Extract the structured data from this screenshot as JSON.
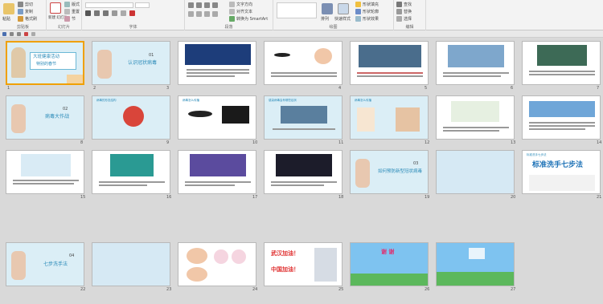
{
  "ribbon": {
    "clipboard": {
      "paste": "粘贴",
      "cut": "剪切",
      "copy": "复制",
      "format_painter": "格式刷",
      "group_label": "剪贴板"
    },
    "slides": {
      "new_slide": "新建\n幻灯片",
      "layout": "版式",
      "reset": "重置",
      "section": "节",
      "group_label": "幻灯片"
    },
    "font": {
      "group_label": "字体"
    },
    "paragraph": {
      "text_direction": "文字方向",
      "align_text": "对齐文本",
      "convert_smartart": "转换为 SmartArt",
      "group_label": "段落"
    },
    "drawing": {
      "arrange": "排列",
      "quick_styles": "快速样式",
      "shape_fill": "形状填充",
      "shape_outline": "形状轮廓",
      "shape_effects": "形状效果",
      "group_label": "绘图"
    },
    "editing": {
      "find": "查找",
      "replace": "替换",
      "select": "选择",
      "group_label": "编辑"
    }
  },
  "slides": [
    {
      "n": "1",
      "title": "大班健康活动",
      "subtitle": "特别的春节"
    },
    {
      "n": "2",
      "num": "01",
      "title": "认识冠状病毒"
    },
    {
      "n": "3"
    },
    {
      "n": "4"
    },
    {
      "n": "5"
    },
    {
      "n": "6"
    },
    {
      "n": "7"
    },
    {
      "n": "8",
      "num": "02",
      "title": "病毒大作战"
    },
    {
      "n": "9",
      "header": "病毒的形态结构"
    },
    {
      "n": "10",
      "header": "病毒怎么传播"
    },
    {
      "n": "11",
      "header": "感染病毒会有哪些症状"
    },
    {
      "n": "12",
      "header": "病毒怎么传播"
    },
    {
      "n": "13"
    },
    {
      "n": "14"
    },
    {
      "n": "15"
    },
    {
      "n": "16"
    },
    {
      "n": "17"
    },
    {
      "n": "18"
    },
    {
      "n": "19",
      "num": "03",
      "title": "如何预防新型冠状病毒"
    },
    {
      "n": "20"
    },
    {
      "n": "21",
      "header": "标准洗手七步法",
      "big": "标准洗手七步法"
    },
    {
      "n": "22",
      "num": "04",
      "title": "七步洗手法"
    },
    {
      "n": "23"
    },
    {
      "n": "24"
    },
    {
      "n": "25",
      "line1": "武汉加油！",
      "line2": "中国加油！"
    },
    {
      "n": "26",
      "title": "谢 谢"
    },
    {
      "n": "27"
    }
  ]
}
